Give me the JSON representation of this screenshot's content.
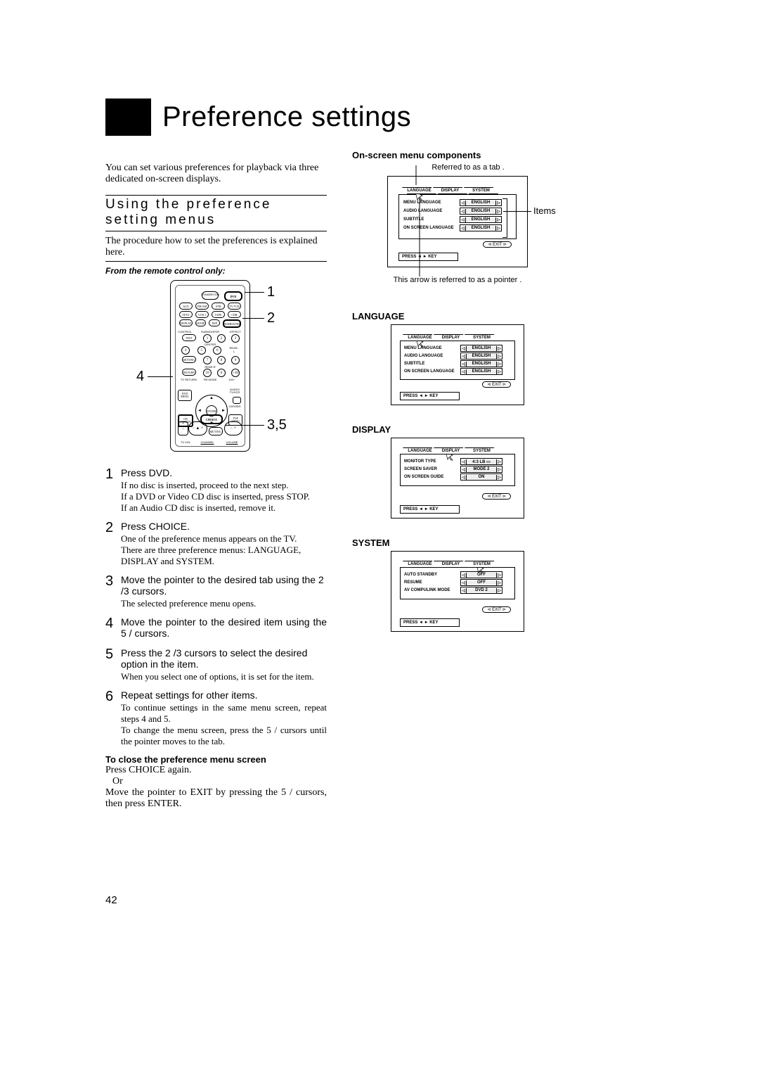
{
  "page_number": "42",
  "title": "Preference settings",
  "intro": "You can set various preferences for playback via three dedicated on-screen displays.",
  "section_heading": "Using the preference setting menus",
  "procedure_intro": "The procedure how to set the preferences is explained here.",
  "remote_only": "From the remote control only:",
  "remote_leads": {
    "n1": "1",
    "n2": "2",
    "n4": "4",
    "n35": "3,5"
  },
  "steps": [
    {
      "num": "1",
      "head": "Press DVD.",
      "body": "If no disc is inserted, proceed to the next step.\nIf a DVD or Video CD disc is inserted, press STOP.\nIf an Audio CD disc is inserted, remove it."
    },
    {
      "num": "2",
      "head": "Press CHOICE.",
      "body": "One of the preference menus appears on the TV.\nThere are three preference menus: LANGUAGE, DISPLAY and SYSTEM."
    },
    {
      "num": "3",
      "head": "Move the pointer to the desired tab using the 2 /3  cursors.",
      "body": "The selected preference menu opens."
    },
    {
      "num": "4",
      "head": "Move the pointer to the desired item using the 5 /   cursors.",
      "body": ""
    },
    {
      "num": "5",
      "head": "Press the 2 /3  cursors to select the desired option in the item.",
      "body": "When you select one of options, it is set for the item."
    },
    {
      "num": "6",
      "head": "Repeat settings for other items.",
      "body": "To continue settings in the same menu screen, repeat steps 4 and 5.\nTo change the menu screen, press the 5 /   cursors until the pointer moves to the tab."
    }
  ],
  "close": {
    "head": "To close the preference menu screen",
    "l1": "Press CHOICE again.",
    "l2": "Or",
    "l3": "Move the pointer to  EXIT  by pressing the  5 /   cursors, then press ENTER."
  },
  "right": {
    "components_head": "On-screen menu components",
    "tab_note": "Referred to as a  tab .",
    "pointer_note": "This arrow is referred to as a  pointer .",
    "items_label": "Items",
    "tabs": {
      "language": "LANGUAGE",
      "display": "DISPLAY",
      "system": "SYSTEM"
    },
    "lang": {
      "head": "LANGUAGE",
      "items": [
        {
          "lbl": "MENU LANGUAGE",
          "val": "ENGLISH"
        },
        {
          "lbl": "AUDIO LANGUAGE",
          "val": "ENGLISH"
        },
        {
          "lbl": "SUBTITLE",
          "val": "ENGLISH"
        },
        {
          "lbl": "ON SCREEN LANGUAGE",
          "val": "ENGLISH"
        }
      ]
    },
    "disp": {
      "head": "DISPLAY",
      "items": [
        {
          "lbl": "MONITOR TYPE",
          "val": "4:3 LB ▭"
        },
        {
          "lbl": "SCREEN SAVER",
          "val": "MODE 2"
        },
        {
          "lbl": "ON SCREEN GUIDE",
          "val": "ON"
        }
      ]
    },
    "sys": {
      "head": "SYSTEM",
      "items": [
        {
          "lbl": "AUTO STANDBY",
          "val": "OFF"
        },
        {
          "lbl": "RESUME",
          "val": "OFF"
        },
        {
          "lbl": "AV COMPULINK MODE",
          "val": "DVD 2"
        }
      ]
    },
    "exit": "EXIT",
    "footer": "PRESS ◄ ► KEY"
  },
  "remote_labels": {
    "standby": "STANDBY/ON",
    "dvd": "DVD",
    "aux": "AUX",
    "fmam": "FM/AM",
    "stb": "STB",
    "tvvcr": "TV/VCR",
    "text": "TEXT",
    "vcr1": "VCR 1",
    "tape": "TAPE",
    "cdr": "CDR",
    "display": "DISPLAY",
    "sleep": "SLEEP",
    "dsp": "DSP",
    "surround": "SURROUND",
    "control": "CONTROL",
    "subwoofer": "SUBWOOFER",
    "effect": "EFFECT",
    "test": "TEST",
    "center": "CENTER",
    "rearl": "REAR-L",
    "rearr": "REAR-R",
    "tvreturn": "TV RETURN",
    "fmmode": "FM MODE",
    "hundred": "100+",
    "setting": "SETTING",
    "return": "RETURN",
    "dvdmenu": "DVD\nMENU",
    "audio_tvvcr": "AUDIO/\nTV/VCR",
    "catvdbs": "CAT/DBS",
    "onscreen_lbl": "ON\nSCREEN",
    "choice": "CHOICE",
    "topmenu": "TOP\nMENU",
    "enter": "ENTER",
    "tvvol": "TV VOL",
    "channel": "CHANNEL",
    "volume": "VOLUME",
    "muting": "MUTING"
  }
}
